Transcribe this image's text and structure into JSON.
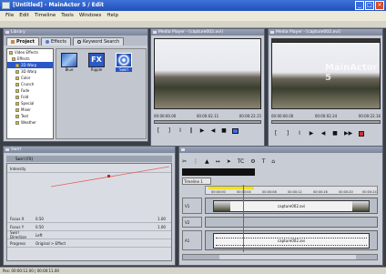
{
  "window": {
    "title": "[Untitled] - MainActor 5 / Edit"
  },
  "menu": [
    "File",
    "Edit",
    "Timeline",
    "Tools",
    "Windows",
    "Help"
  ],
  "library": {
    "title": "Library",
    "tabs": [
      "Project",
      "Effects",
      "Keyword Search"
    ],
    "tree": [
      "Video Effects",
      "Effects",
      "2D Warp",
      "3D Warp",
      "Color",
      "Crunch",
      "Fade",
      "Fold",
      "Special",
      "Mixer",
      "Text",
      "Weather"
    ],
    "effects": [
      "Blue",
      "Ripple",
      "Swirl"
    ]
  },
  "source_monitor": {
    "title": "Media Player - [capture002.avi]",
    "timecodes": [
      "00:00:00.00",
      "00:00:02.11",
      "00:00:22.15"
    ]
  },
  "program_monitor": {
    "title": "Media Player - [capture002.avi]",
    "overlay": "MainActor 5",
    "timecodes": [
      "00:00:00.00",
      "00:00:02.24",
      "00:00:22.16"
    ],
    "controls": [
      "[",
      "]",
      "I",
      "‖",
      "▶",
      "◀",
      "■",
      "▶▶"
    ]
  },
  "effect_panel": {
    "title": "Swirl",
    "header": "Swirl (FX)",
    "rows": [
      {
        "label": "Intensity",
        "v1": "0.00",
        "v2": "1.00"
      },
      {
        "label": "Focus X",
        "v1": "0.50",
        "v2": "1.00"
      },
      {
        "label": "Focus Y",
        "v1": "0.50",
        "v2": "1.00"
      },
      {
        "label": "Swirl Direction",
        "v1": "Left",
        "v2": ""
      },
      {
        "label": "Progress",
        "v1": "Original > Effect",
        "v2": ""
      }
    ]
  },
  "timeline": {
    "title": "Timeline 1",
    "ruler": [
      "00:00:00",
      "00:00:04",
      "00:00:08",
      "00:00:12",
      "00:00:16",
      "00:00:20",
      "00:00:24"
    ],
    "tracks": [
      {
        "label": "V1",
        "clip": "capture002.avi"
      },
      {
        "label": "V2",
        "clip": ""
      },
      {
        "label": "A1",
        "clip": "capture002.avi"
      }
    ]
  },
  "status": "Pos: 00:00:12.00 | 00:00:11.00"
}
